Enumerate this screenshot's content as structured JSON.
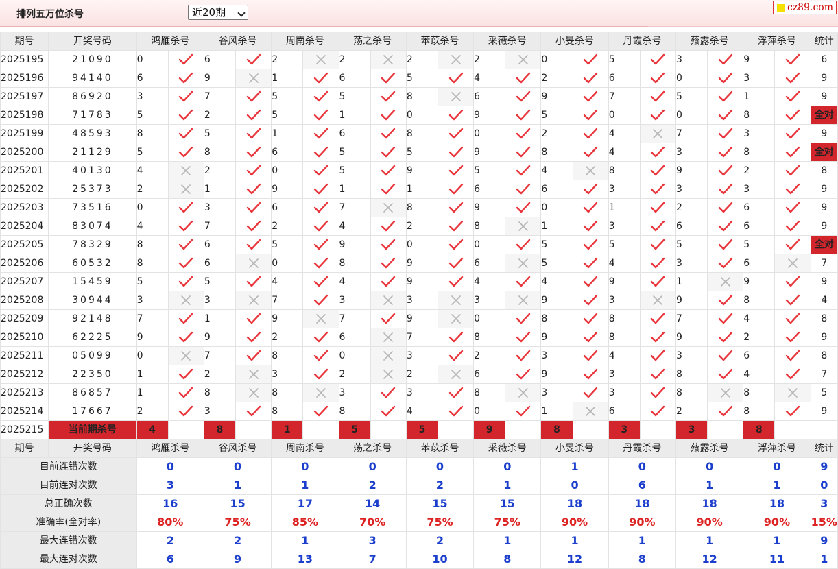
{
  "header": {
    "title": "排列五万位杀号",
    "period_select": "近20期",
    "brand": "cz89.com"
  },
  "columns": {
    "period": "期号",
    "draw": "开奖号码",
    "experts": [
      "鸿雁杀号",
      "谷风杀号",
      "周南杀号",
      "荡之杀号",
      "苯苡杀号",
      "采薇杀号",
      "小旻杀号",
      "丹霞杀号",
      "蕵露杀号",
      "浮萍杀号"
    ],
    "stat": "统计"
  },
  "rows": [
    {
      "period": "2025195",
      "draw": "21090",
      "picks": [
        0,
        6,
        2,
        2,
        2,
        2,
        0,
        5,
        3,
        9
      ],
      "marks": [
        1,
        1,
        0,
        0,
        0,
        0,
        1,
        1,
        1,
        1
      ],
      "count": "6"
    },
    {
      "period": "2025196",
      "draw": "94140",
      "picks": [
        6,
        9,
        1,
        6,
        5,
        4,
        2,
        6,
        0,
        3
      ],
      "marks": [
        1,
        0,
        1,
        1,
        1,
        1,
        1,
        1,
        1,
        1
      ],
      "count": "9"
    },
    {
      "period": "2025197",
      "draw": "86920",
      "picks": [
        3,
        7,
        5,
        5,
        8,
        6,
        9,
        7,
        5,
        1
      ],
      "marks": [
        1,
        1,
        1,
        1,
        0,
        1,
        1,
        1,
        1,
        1
      ],
      "count": "9"
    },
    {
      "period": "2025198",
      "draw": "71783",
      "picks": [
        5,
        2,
        5,
        1,
        0,
        9,
        5,
        0,
        0,
        8
      ],
      "marks": [
        1,
        1,
        1,
        1,
        1,
        1,
        1,
        1,
        1,
        1
      ],
      "count": "全对"
    },
    {
      "period": "2025199",
      "draw": "48593",
      "picks": [
        8,
        5,
        1,
        6,
        8,
        0,
        2,
        4,
        7,
        3
      ],
      "marks": [
        1,
        1,
        1,
        1,
        1,
        1,
        1,
        0,
        1,
        1
      ],
      "count": "9"
    },
    {
      "period": "2025200",
      "draw": "21129",
      "picks": [
        5,
        8,
        6,
        5,
        5,
        9,
        8,
        4,
        3,
        8
      ],
      "marks": [
        1,
        1,
        1,
        1,
        1,
        1,
        1,
        1,
        1,
        1
      ],
      "count": "全对"
    },
    {
      "period": "2025201",
      "draw": "40130",
      "picks": [
        4,
        2,
        0,
        5,
        9,
        5,
        4,
        8,
        9,
        2
      ],
      "marks": [
        0,
        1,
        1,
        1,
        1,
        1,
        0,
        1,
        1,
        1
      ],
      "count": "8"
    },
    {
      "period": "2025202",
      "draw": "25373",
      "picks": [
        2,
        1,
        9,
        1,
        1,
        6,
        6,
        3,
        3,
        3
      ],
      "marks": [
        0,
        1,
        1,
        1,
        1,
        1,
        1,
        1,
        1,
        1
      ],
      "count": "9"
    },
    {
      "period": "2025203",
      "draw": "73516",
      "picks": [
        0,
        3,
        6,
        7,
        8,
        9,
        0,
        1,
        2,
        6
      ],
      "marks": [
        1,
        1,
        1,
        0,
        1,
        1,
        1,
        1,
        1,
        1
      ],
      "count": "9"
    },
    {
      "period": "2025204",
      "draw": "83074",
      "picks": [
        4,
        7,
        2,
        4,
        2,
        8,
        1,
        3,
        6,
        6
      ],
      "marks": [
        1,
        1,
        1,
        1,
        1,
        0,
        1,
        1,
        1,
        1
      ],
      "count": "9"
    },
    {
      "period": "2025205",
      "draw": "78329",
      "picks": [
        8,
        6,
        5,
        9,
        0,
        0,
        5,
        5,
        5,
        5
      ],
      "marks": [
        1,
        1,
        1,
        1,
        1,
        1,
        1,
        1,
        1,
        1
      ],
      "count": "全对"
    },
    {
      "period": "2025206",
      "draw": "60532",
      "picks": [
        8,
        6,
        0,
        8,
        9,
        6,
        5,
        4,
        3,
        6
      ],
      "marks": [
        1,
        0,
        1,
        1,
        1,
        0,
        1,
        1,
        1,
        0
      ],
      "count": "7"
    },
    {
      "period": "2025207",
      "draw": "15459",
      "picks": [
        5,
        5,
        4,
        4,
        9,
        4,
        4,
        9,
        1,
        9
      ],
      "marks": [
        1,
        1,
        1,
        1,
        1,
        1,
        1,
        1,
        0,
        1
      ],
      "count": "9"
    },
    {
      "period": "2025208",
      "draw": "30944",
      "picks": [
        3,
        3,
        7,
        3,
        3,
        3,
        9,
        3,
        9,
        8
      ],
      "marks": [
        0,
        0,
        1,
        0,
        0,
        0,
        1,
        0,
        1,
        1
      ],
      "count": "4"
    },
    {
      "period": "2025209",
      "draw": "92148",
      "picks": [
        7,
        1,
        9,
        7,
        9,
        0,
        8,
        8,
        7,
        4
      ],
      "marks": [
        1,
        1,
        0,
        1,
        0,
        1,
        1,
        1,
        1,
        1
      ],
      "count": "8"
    },
    {
      "period": "2025210",
      "draw": "62225",
      "picks": [
        9,
        9,
        2,
        6,
        7,
        8,
        9,
        8,
        9,
        2
      ],
      "marks": [
        1,
        1,
        1,
        0,
        1,
        1,
        1,
        1,
        1,
        1
      ],
      "count": "9"
    },
    {
      "period": "2025211",
      "draw": "05099",
      "picks": [
        0,
        7,
        8,
        0,
        3,
        2,
        3,
        4,
        3,
        6
      ],
      "marks": [
        0,
        1,
        1,
        0,
        1,
        1,
        1,
        1,
        1,
        1
      ],
      "count": "8"
    },
    {
      "period": "2025212",
      "draw": "22350",
      "picks": [
        1,
        2,
        3,
        2,
        2,
        6,
        9,
        3,
        8,
        4
      ],
      "marks": [
        1,
        0,
        1,
        0,
        0,
        1,
        1,
        1,
        1,
        1
      ],
      "count": "7"
    },
    {
      "period": "2025213",
      "draw": "86857",
      "picks": [
        1,
        8,
        8,
        3,
        3,
        8,
        3,
        3,
        8,
        8
      ],
      "marks": [
        1,
        0,
        0,
        1,
        1,
        0,
        1,
        1,
        0,
        0
      ],
      "count": "5"
    },
    {
      "period": "2025214",
      "draw": "17667",
      "picks": [
        2,
        3,
        8,
        8,
        4,
        0,
        1,
        6,
        2,
        8
      ],
      "marks": [
        1,
        1,
        1,
        1,
        1,
        1,
        0,
        1,
        1,
        1
      ],
      "count": "9"
    }
  ],
  "current": {
    "period": "2025215",
    "label": "当前期杀号",
    "picks": [
      "4",
      "8",
      "1",
      "5",
      "5",
      "9",
      "8",
      "3",
      "3",
      "8"
    ]
  },
  "stats": [
    {
      "label": "目前连错次数",
      "values": [
        "0",
        "0",
        "0",
        "0",
        "0",
        "0",
        "1",
        "0",
        "0",
        "0"
      ],
      "total": "9"
    },
    {
      "label": "目前连对次数",
      "values": [
        "3",
        "1",
        "1",
        "2",
        "2",
        "1",
        "0",
        "6",
        "1",
        "1"
      ],
      "total": "0"
    },
    {
      "label": "总正确次数",
      "values": [
        "16",
        "15",
        "17",
        "14",
        "15",
        "15",
        "18",
        "18",
        "18",
        "18"
      ],
      "total": "3"
    },
    {
      "label": "准确率(全对率)",
      "values": [
        "80%",
        "75%",
        "85%",
        "70%",
        "75%",
        "75%",
        "90%",
        "90%",
        "90%",
        "90%"
      ],
      "total": "15%"
    },
    {
      "label": "最大连错次数",
      "values": [
        "2",
        "2",
        "1",
        "3",
        "2",
        "1",
        "1",
        "1",
        "1",
        "1"
      ],
      "total": "9"
    },
    {
      "label": "最大连对次数",
      "values": [
        "6",
        "9",
        "13",
        "7",
        "10",
        "8",
        "12",
        "8",
        "12",
        "11"
      ],
      "total": "1"
    }
  ],
  "icons": {
    "correct": "check-icon",
    "wrong": "cross-icon"
  },
  "colors": {
    "accent": "#d3262c",
    "stat_blue": "#1b3fcc",
    "check": "#e8363c",
    "cross": "#b5b5b5"
  }
}
